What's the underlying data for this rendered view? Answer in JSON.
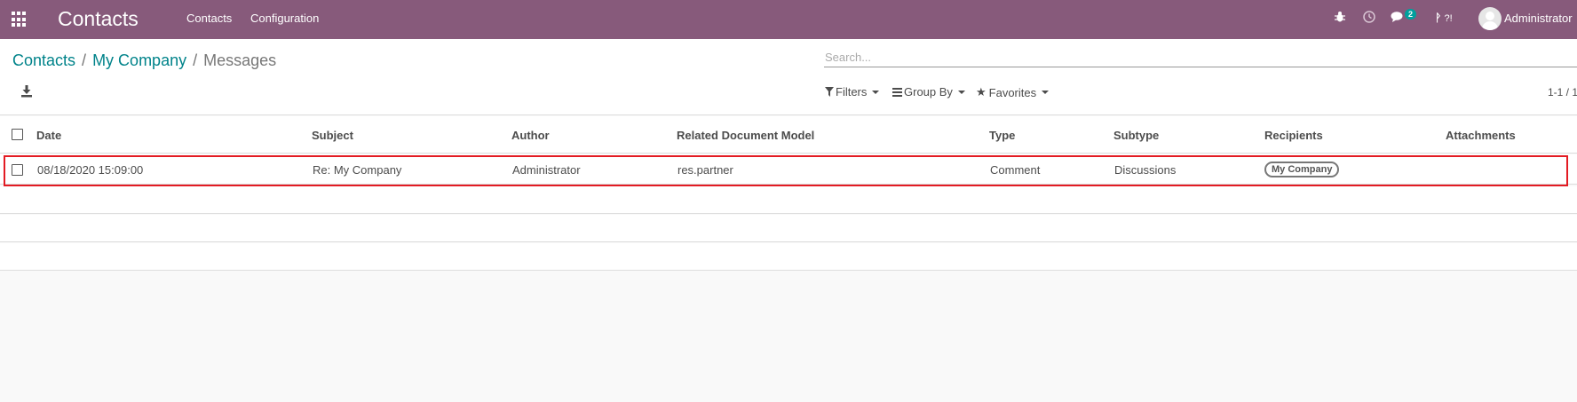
{
  "navbar": {
    "brand": "Contacts",
    "menu": [
      "Contacts",
      "Configuration"
    ],
    "chat_badge": "2",
    "shortcut_text": "?!",
    "user": "Administrator"
  },
  "breadcrumb": {
    "items": [
      "Contacts",
      "My Company"
    ],
    "current": "Messages"
  },
  "search": {
    "placeholder": "Search..."
  },
  "filters": {
    "filters_label": "Filters",
    "groupby_label": "Group By",
    "favorites_label": "Favorites"
  },
  "pager": {
    "text": "1-1 / 1"
  },
  "table": {
    "columns": [
      "Date",
      "Subject",
      "Author",
      "Related Document Model",
      "Type",
      "Subtype",
      "Recipients",
      "Attachments"
    ],
    "rows": [
      {
        "date": "08/18/2020 15:09:00",
        "subject": "Re: My Company",
        "author": "Administrator",
        "model": "res.partner",
        "type": "Comment",
        "subtype": "Discussions",
        "recipients": "My Company",
        "attachments": ""
      }
    ]
  },
  "colors": {
    "navbar": "#875a7b",
    "link": "#00838a",
    "highlight": "#e31b23"
  }
}
